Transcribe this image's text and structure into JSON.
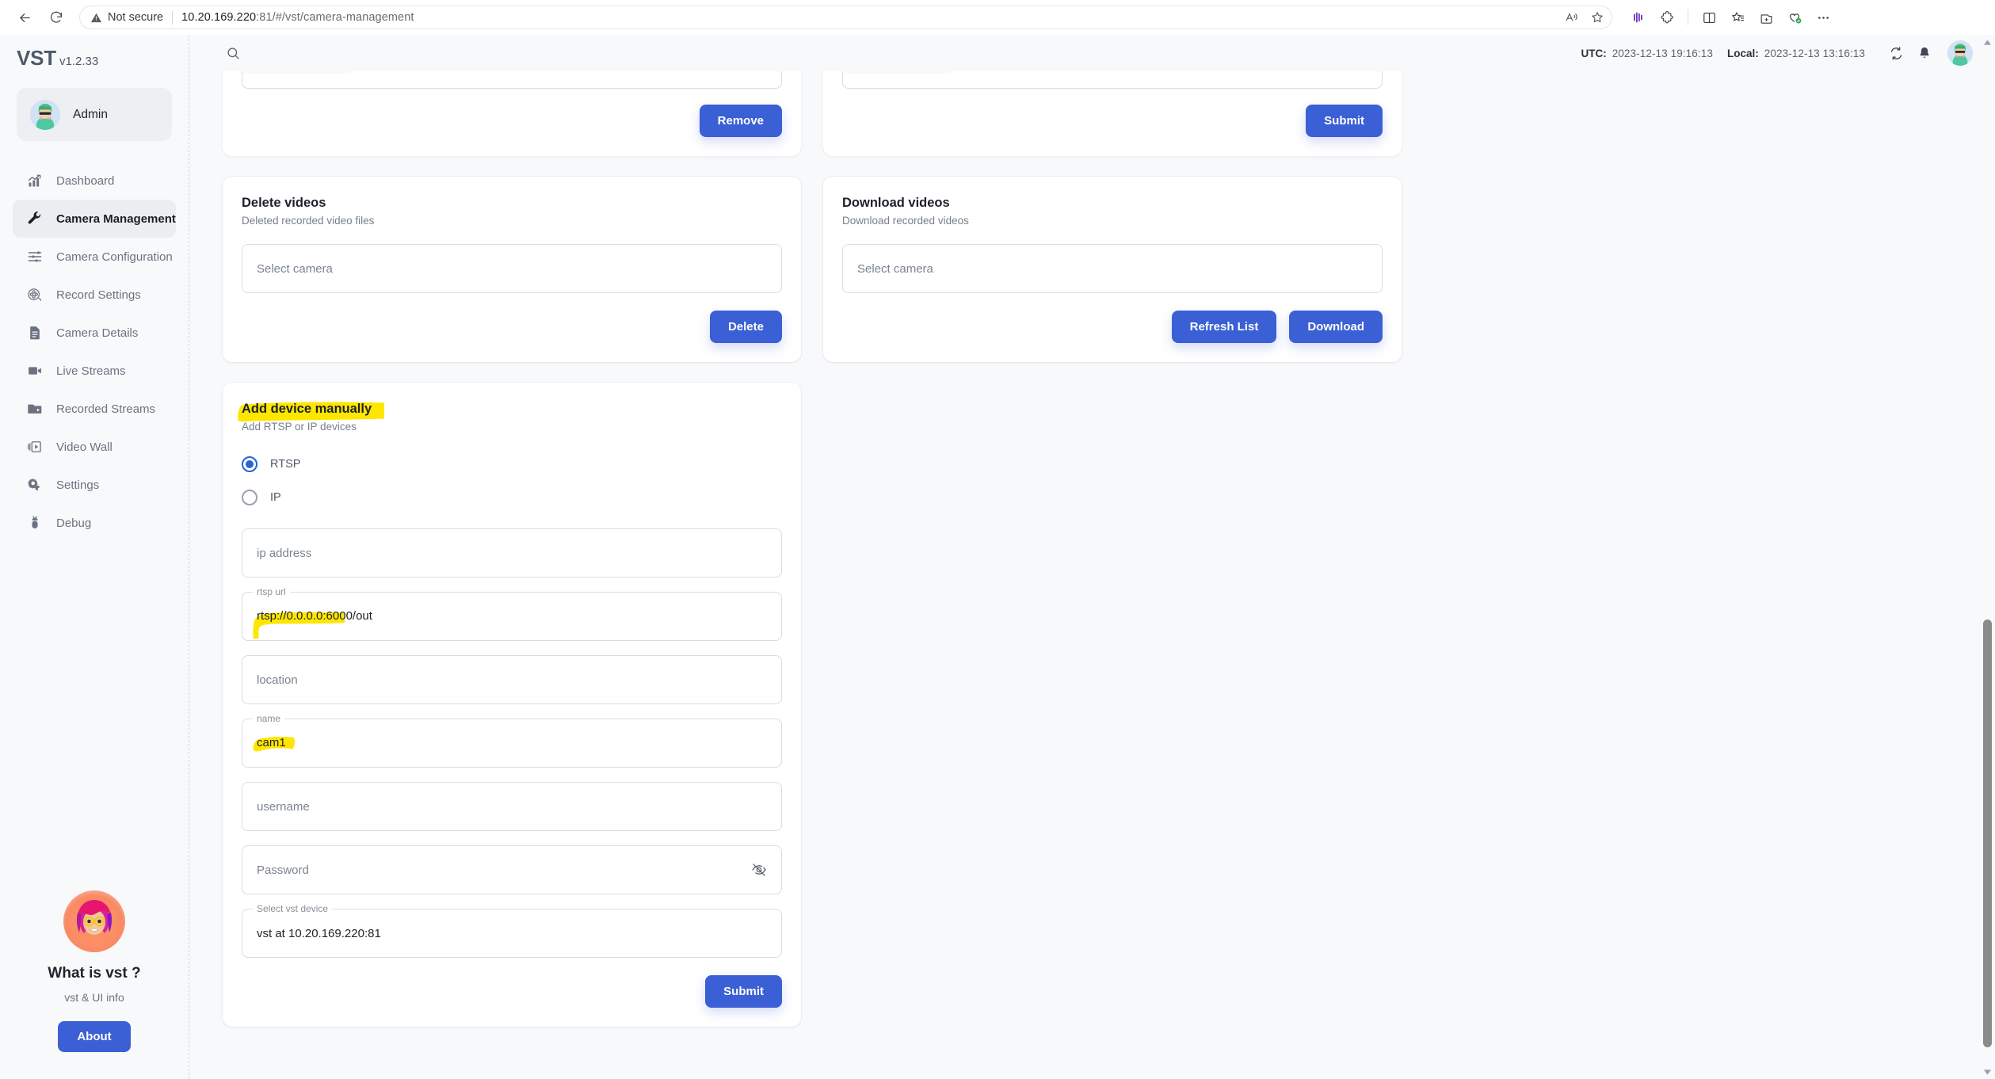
{
  "browser": {
    "back_icon": "back-arrow-icon",
    "reload_icon": "reload-icon",
    "security_label": "Not secure",
    "url_host": "10.20.169.220",
    "url_rest": ":81/#/vst/camera-management",
    "url_full": "10.20.169.220:81/#/vst/camera-management",
    "omnibox_icons": [
      "read-aloud-icon",
      "favorite-star-icon"
    ],
    "toolbar_icons": [
      "copilot-icon",
      "extensions-puzzle-icon",
      "split-screen-icon",
      "favorites-list-icon",
      "collections-icon",
      "browser-essentials-icon",
      "settings-more-icon"
    ]
  },
  "sidebar": {
    "brand": "VST",
    "version": "v1.2.33",
    "user": {
      "name": "Admin",
      "avatar": "admin-avatar"
    },
    "items": [
      {
        "label": "Dashboard",
        "icon": "chart-bars-icon",
        "active": false
      },
      {
        "label": "Camera Management",
        "icon": "wrench-icon",
        "active": true
      },
      {
        "label": "Camera Configuration",
        "icon": "sliders-icon",
        "active": false
      },
      {
        "label": "Record Settings",
        "icon": "film-reel-icon",
        "active": false
      },
      {
        "label": "Camera Details",
        "icon": "document-icon",
        "active": false
      },
      {
        "label": "Live Streams",
        "icon": "video-camera-icon",
        "active": false
      },
      {
        "label": "Recorded Streams",
        "icon": "folder-play-icon",
        "active": false
      },
      {
        "label": "Video Wall",
        "icon": "video-wall-icon",
        "active": false
      },
      {
        "label": "Settings",
        "icon": "gears-icon",
        "active": false
      },
      {
        "label": "Debug",
        "icon": "bug-icon",
        "active": false
      }
    ],
    "promo": {
      "avatar": "vst-mascot-avatar",
      "title": "What is vst ?",
      "subtitle": "vst & UI info",
      "button": "About"
    }
  },
  "header": {
    "search_icon": "search-icon",
    "utc_label": "UTC:",
    "utc_value": "2023-12-13 19:16:13",
    "local_label": "Local:",
    "local_value": "2023-12-13 13:16:13",
    "refresh_icon": "refresh-sync-icon",
    "bell_icon": "notification-bell-icon",
    "avatar": "user-avatar"
  },
  "cards": {
    "partial_left": {
      "button": "Remove"
    },
    "partial_right": {
      "button": "Submit"
    },
    "delete_videos": {
      "title": "Delete videos",
      "subtitle": "Deleted recorded video files",
      "select_placeholder": "Select camera",
      "button": "Delete"
    },
    "download_videos": {
      "title": "Download videos",
      "subtitle": "Download recorded videos",
      "select_placeholder": "Select camera",
      "refresh_button": "Refresh List",
      "download_button": "Download"
    },
    "add_device": {
      "title": "Add device manually",
      "subtitle": "Add RTSP or IP devices",
      "radios": [
        {
          "label": "RTSP",
          "checked": true
        },
        {
          "label": "IP",
          "checked": false
        }
      ],
      "fields": [
        {
          "name": "ip-address",
          "placeholder": "ip address",
          "value": "",
          "label": ""
        },
        {
          "name": "rtsp-url",
          "placeholder": "",
          "value": "rtsp://0.0.0.0:6000/out",
          "label": "rtsp url",
          "highlighted": true
        },
        {
          "name": "location",
          "placeholder": "location",
          "value": "",
          "label": ""
        },
        {
          "name": "camera-name",
          "placeholder": "",
          "value": "cam1",
          "label": "name",
          "highlighted": true
        },
        {
          "name": "username",
          "placeholder": "username",
          "value": "",
          "label": ""
        },
        {
          "name": "password",
          "placeholder": "Password",
          "value": "",
          "label": "",
          "trailing_icon": "eye-off-icon"
        },
        {
          "name": "select-vst-device",
          "placeholder": "",
          "value": "vst at 10.20.169.220:81",
          "label": "Select vst device"
        }
      ],
      "button": "Submit"
    }
  },
  "colors": {
    "accent_blue": "#3b5fd4",
    "highlight_yellow": "#ffe600",
    "page_bg": "#f8f9fb",
    "card_bg": "#ffffff",
    "sidebar_active_bg": "#ebedf1"
  },
  "scrollbar": {
    "up_arrow": "scroll-up-arrow-icon",
    "down_arrow": "scroll-down-arrow-icon"
  }
}
